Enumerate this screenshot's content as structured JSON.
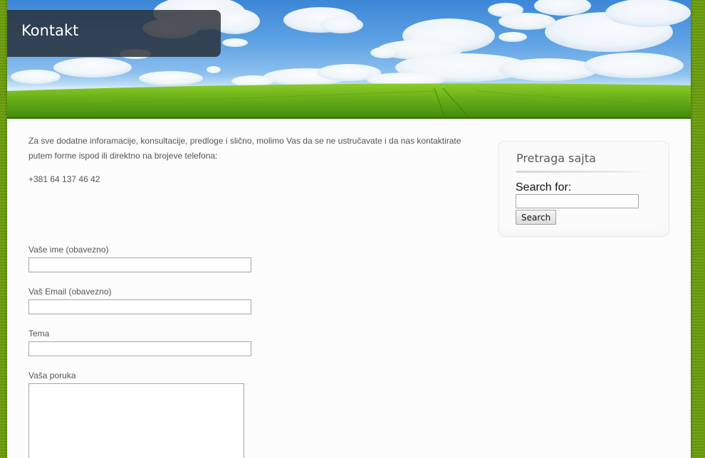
{
  "page": {
    "title": "Kontakt"
  },
  "content": {
    "intro": "Za sve dodatne inforamacije, konsultacije, predloge i slično, molimo Vas da se ne ustručavate i da nas kontaktirate putem forme ispod ili direktno na brojeve telefona:",
    "phone": "+381 64 137 46 42"
  },
  "form": {
    "name_label": "Vaše ime (obavezno)",
    "name_value": "",
    "email_label": "Vaš Email (obavezno)",
    "email_value": "",
    "subject_label": "Tema",
    "subject_value": "",
    "message_label": "Vaša poruka",
    "message_value": ""
  },
  "sidebar": {
    "widget_title": "Pretraga sajta",
    "search_label": "Search for:",
    "search_value": "",
    "search_button": "Search"
  },
  "colors": {
    "background_green": "#6a9a12",
    "title_box": "#282d34",
    "text": "#555555"
  }
}
